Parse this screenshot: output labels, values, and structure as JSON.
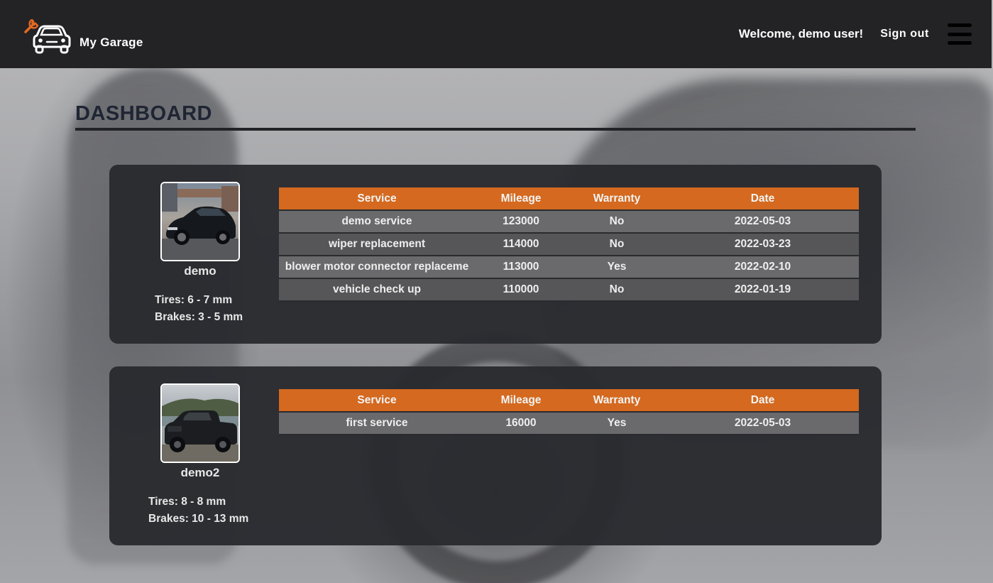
{
  "header": {
    "brand_name": "My Garage",
    "welcome_text": "Welcome, demo user!",
    "signout_label": "Sign out",
    "logo_icon": "car-wrench-icon",
    "menu_icon": "hamburger-menu-icon"
  },
  "page": {
    "title": "DASHBOARD"
  },
  "colors": {
    "accent": "#d4691f",
    "header_bg": "#232325",
    "card_bg": "#2a2b2f",
    "row_light": "#6a6a6c",
    "row_dark": "#565658"
  },
  "table_headers": {
    "service": "Service",
    "mileage": "Mileage",
    "warranty": "Warranty",
    "date": "Date"
  },
  "vehicles": [
    {
      "name": "demo",
      "photo_icon": "black-sedan-photo",
      "tires": "Tires: 6 - 7 mm",
      "brakes": "Brakes: 3 - 5 mm",
      "services": [
        {
          "service": "demo service",
          "mileage": "123000",
          "warranty": "No",
          "date": "2022-05-03"
        },
        {
          "service": "wiper replacement",
          "mileage": "114000",
          "warranty": "No",
          "date": "2022-03-23"
        },
        {
          "service": "blower motor connector replaceme",
          "mileage": "113000",
          "warranty": "Yes",
          "date": "2022-02-10"
        },
        {
          "service": "vehicle check up",
          "mileage": "110000",
          "warranty": "No",
          "date": "2022-01-19"
        }
      ]
    },
    {
      "name": "demo2",
      "photo_icon": "black-pickup-truck-photo",
      "tires": "Tires: 8 - 8 mm",
      "brakes": "Brakes: 10 - 13 mm",
      "services": [
        {
          "service": "first service",
          "mileage": "16000",
          "warranty": "Yes",
          "date": "2022-05-03"
        }
      ]
    }
  ]
}
